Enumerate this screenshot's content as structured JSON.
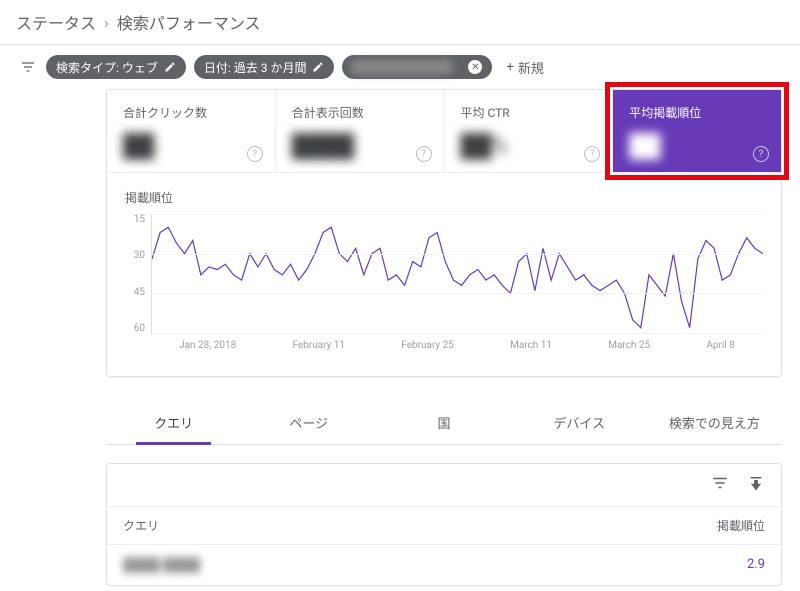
{
  "breadcrumb": {
    "root": "ステータス",
    "current": "検索パフォーマンス"
  },
  "filters": {
    "search_type": "検索タイプ: ウェブ",
    "date_range": "日付: 過去 3 か月間",
    "redacted": "――",
    "add_new": "新規"
  },
  "metrics": [
    {
      "label": "合計クリック数",
      "value": "██"
    },
    {
      "label": "合計表示回数",
      "value": "████"
    },
    {
      "label": "平均 CTR",
      "value": "██%",
      "suffix": ""
    },
    {
      "label": "平均掲載順位",
      "value": "██",
      "active": true
    }
  ],
  "chart_data": {
    "type": "line",
    "title": "掲載順位",
    "ylabel": "",
    "xlabel": "",
    "ylim": [
      60,
      15
    ],
    "y_ticks": [
      15,
      30,
      45,
      60
    ],
    "x_ticks": [
      "Jan 28, 2018",
      "February 11",
      "February 25",
      "March 11",
      "March 25",
      "April 8"
    ],
    "values": [
      32,
      22,
      20,
      26,
      30,
      25,
      38,
      35,
      36,
      34,
      38,
      40,
      30,
      35,
      30,
      36,
      38,
      34,
      40,
      36,
      30,
      22,
      20,
      30,
      33,
      28,
      38,
      30,
      28,
      40,
      38,
      42,
      33,
      35,
      24,
      22,
      33,
      40,
      42,
      38,
      36,
      40,
      38,
      42,
      45,
      33,
      30,
      44,
      28,
      40,
      30,
      35,
      40,
      38,
      42,
      44,
      42,
      40,
      45,
      55,
      58,
      38,
      42,
      46,
      30,
      48,
      58,
      32,
      25,
      28,
      40,
      38,
      30,
      24,
      28,
      30
    ]
  },
  "tabs": [
    "クエリ",
    "ページ",
    "国",
    "デバイス",
    "検索での見え方"
  ],
  "table": {
    "col_query": "クエリ",
    "col_position": "掲載順位",
    "rows": [
      {
        "query": "████ ████",
        "position": "2.9"
      }
    ]
  }
}
